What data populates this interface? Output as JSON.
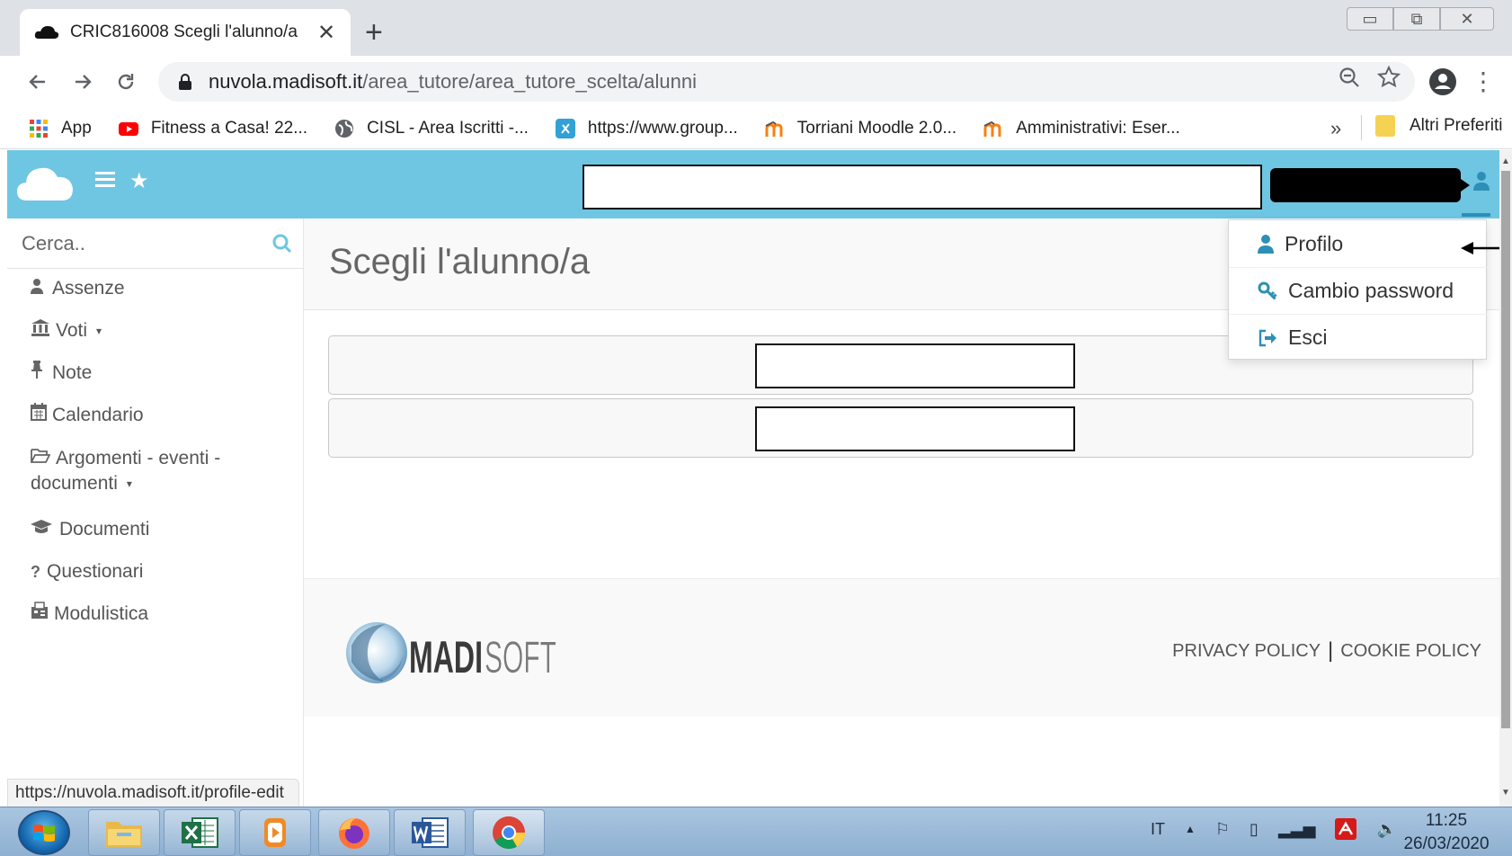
{
  "browser": {
    "tab_title": "CRIC816008 Scegli l'alunno/a",
    "tab_close": "✕",
    "new_tab": "+",
    "url_host": "nuvola.madisoft.it",
    "url_path": "/area_tutore/area_tutore_scelta/alunni",
    "bookmarks": [
      {
        "label": "App",
        "icon": "apps-grid-icon",
        "color": "#4285f4"
      },
      {
        "label": "Fitness a Casa! 22...",
        "icon": "youtube-icon",
        "color": "#ff0000"
      },
      {
        "label": "CISL - Area Iscritti -...",
        "icon": "globe-icon",
        "color": "#5f6368"
      },
      {
        "label": "https://www.group...",
        "icon": "group-site-icon",
        "color": "#33a1d6"
      },
      {
        "label": "Torriani Moodle 2.0...",
        "icon": "moodle-icon",
        "color": "#f98012"
      },
      {
        "label": "Amministrativi: Eser...",
        "icon": "moodle-icon",
        "color": "#f98012"
      }
    ],
    "bookmarks_more": "»",
    "other_bookmarks": "Altri Preferiti",
    "status_url": "https://nuvola.madisoft.it/profile-edit"
  },
  "sidebar": {
    "search_placeholder": "Cerca..",
    "items": [
      {
        "label": "Assenze",
        "icon": "user-icon",
        "glyph": "👤"
      },
      {
        "label": "Voti",
        "icon": "bank-icon",
        "glyph": "🏛",
        "caret": "▾"
      },
      {
        "label": "Note",
        "icon": "pin-icon",
        "glyph": "📌"
      },
      {
        "label": "Calendario",
        "icon": "calendar-icon",
        "glyph": "📅"
      },
      {
        "label": "Argomenti - eventi -",
        "label2": "documenti",
        "icon": "folder-open-icon",
        "glyph": "🗁",
        "caret": "▾"
      },
      {
        "label": "Documenti",
        "icon": "graduation-cap-icon",
        "glyph": "🎓"
      },
      {
        "label": "Questionari",
        "icon": "question-icon",
        "glyph": "?"
      },
      {
        "label": "Modulistica",
        "icon": "fax-icon",
        "glyph": "📠"
      }
    ]
  },
  "main": {
    "title": "Scegli l'alunno/a"
  },
  "dropdown": {
    "items": [
      {
        "label": "Profilo",
        "icon": "user-icon"
      },
      {
        "label": "Cambio password",
        "icon": "key-icon"
      },
      {
        "label": "Esci",
        "icon": "logout-icon"
      }
    ]
  },
  "footer": {
    "logo_text": "MADISOFT",
    "privacy": "PRIVACY POLICY",
    "separator": "|",
    "cookie": "COOKIE POLICY"
  },
  "taskbar": {
    "language": "IT",
    "time": "11:25",
    "date": "26/03/2020"
  },
  "colors": {
    "header": "#6fc6e2",
    "accent": "#2e8fb6"
  }
}
